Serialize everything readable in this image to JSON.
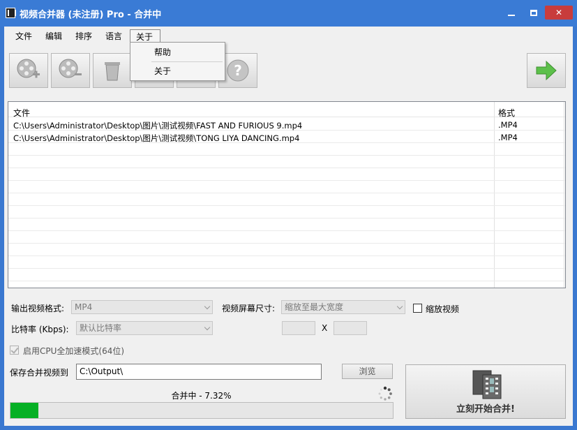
{
  "window": {
    "title": "视频合并器 (未注册) Pro - 合并中"
  },
  "menubar": {
    "items": [
      "文件",
      "编辑",
      "排序",
      "语言",
      "关于"
    ],
    "open_menu": "关于",
    "dropdown_items": [
      "帮助",
      "关于"
    ]
  },
  "toolbar": {
    "buttons": [
      "add-video",
      "remove-video",
      "clear-list",
      "move-up",
      "move-down",
      "help"
    ],
    "next_button": "next"
  },
  "file_list": {
    "columns": [
      "文件",
      "格式"
    ],
    "rows": [
      {
        "file": "C:\\Users\\Administrator\\Desktop\\图片\\测试视频\\FAST AND FURIOUS 9.mp4",
        "format": ".MP4"
      },
      {
        "file": "C:\\Users\\Administrator\\Desktop\\图片\\测试视频\\TONG LIYA DANCING.mp4",
        "format": ".MP4"
      }
    ]
  },
  "settings": {
    "output_format_label": "输出视频格式:",
    "output_format_value": "MP4",
    "screen_size_label": "视频屏幕尺寸:",
    "screen_size_value": "缩放至最大宽度",
    "scale_video_label": "缩放视频",
    "bitrate_label": "比特率 (Kbps):",
    "bitrate_value": "默认比特率",
    "dim_separator": "X",
    "cpu_accel_label": "启用CPU全加速模式(64位)"
  },
  "output": {
    "save_label": "保存合并视频到",
    "path_value": "C:\\Output\\",
    "browse_label": "浏览"
  },
  "progress": {
    "text": "合并中 - 7.32%",
    "percent": 7.32
  },
  "merge_button": {
    "label": "立刻开始合并!"
  },
  "colors": {
    "titlebar": "#3a7bd5",
    "progress_fill": "#06b025",
    "close_button": "#c83c3c"
  }
}
